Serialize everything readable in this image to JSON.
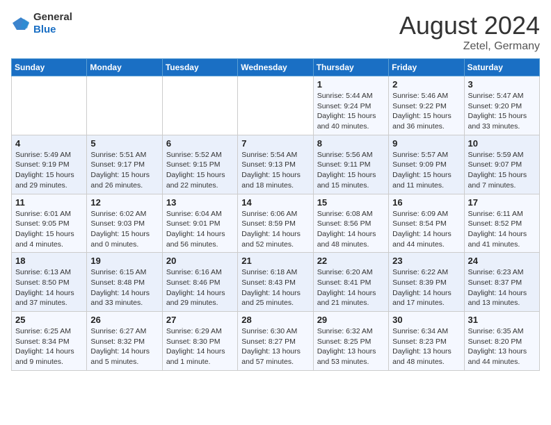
{
  "header": {
    "logo": {
      "general": "General",
      "blue": "Blue"
    },
    "title": "August 2024",
    "location": "Zetel, Germany"
  },
  "days_of_week": [
    "Sunday",
    "Monday",
    "Tuesday",
    "Wednesday",
    "Thursday",
    "Friday",
    "Saturday"
  ],
  "weeks": [
    [
      {
        "day": "",
        "info": ""
      },
      {
        "day": "",
        "info": ""
      },
      {
        "day": "",
        "info": ""
      },
      {
        "day": "",
        "info": ""
      },
      {
        "day": "1",
        "info": "Sunrise: 5:44 AM\nSunset: 9:24 PM\nDaylight: 15 hours\nand 40 minutes."
      },
      {
        "day": "2",
        "info": "Sunrise: 5:46 AM\nSunset: 9:22 PM\nDaylight: 15 hours\nand 36 minutes."
      },
      {
        "day": "3",
        "info": "Sunrise: 5:47 AM\nSunset: 9:20 PM\nDaylight: 15 hours\nand 33 minutes."
      }
    ],
    [
      {
        "day": "4",
        "info": "Sunrise: 5:49 AM\nSunset: 9:19 PM\nDaylight: 15 hours\nand 29 minutes."
      },
      {
        "day": "5",
        "info": "Sunrise: 5:51 AM\nSunset: 9:17 PM\nDaylight: 15 hours\nand 26 minutes."
      },
      {
        "day": "6",
        "info": "Sunrise: 5:52 AM\nSunset: 9:15 PM\nDaylight: 15 hours\nand 22 minutes."
      },
      {
        "day": "7",
        "info": "Sunrise: 5:54 AM\nSunset: 9:13 PM\nDaylight: 15 hours\nand 18 minutes."
      },
      {
        "day": "8",
        "info": "Sunrise: 5:56 AM\nSunset: 9:11 PM\nDaylight: 15 hours\nand 15 minutes."
      },
      {
        "day": "9",
        "info": "Sunrise: 5:57 AM\nSunset: 9:09 PM\nDaylight: 15 hours\nand 11 minutes."
      },
      {
        "day": "10",
        "info": "Sunrise: 5:59 AM\nSunset: 9:07 PM\nDaylight: 15 hours\nand 7 minutes."
      }
    ],
    [
      {
        "day": "11",
        "info": "Sunrise: 6:01 AM\nSunset: 9:05 PM\nDaylight: 15 hours\nand 4 minutes."
      },
      {
        "day": "12",
        "info": "Sunrise: 6:02 AM\nSunset: 9:03 PM\nDaylight: 15 hours\nand 0 minutes."
      },
      {
        "day": "13",
        "info": "Sunrise: 6:04 AM\nSunset: 9:01 PM\nDaylight: 14 hours\nand 56 minutes."
      },
      {
        "day": "14",
        "info": "Sunrise: 6:06 AM\nSunset: 8:59 PM\nDaylight: 14 hours\nand 52 minutes."
      },
      {
        "day": "15",
        "info": "Sunrise: 6:08 AM\nSunset: 8:56 PM\nDaylight: 14 hours\nand 48 minutes."
      },
      {
        "day": "16",
        "info": "Sunrise: 6:09 AM\nSunset: 8:54 PM\nDaylight: 14 hours\nand 44 minutes."
      },
      {
        "day": "17",
        "info": "Sunrise: 6:11 AM\nSunset: 8:52 PM\nDaylight: 14 hours\nand 41 minutes."
      }
    ],
    [
      {
        "day": "18",
        "info": "Sunrise: 6:13 AM\nSunset: 8:50 PM\nDaylight: 14 hours\nand 37 minutes."
      },
      {
        "day": "19",
        "info": "Sunrise: 6:15 AM\nSunset: 8:48 PM\nDaylight: 14 hours\nand 33 minutes."
      },
      {
        "day": "20",
        "info": "Sunrise: 6:16 AM\nSunset: 8:46 PM\nDaylight: 14 hours\nand 29 minutes."
      },
      {
        "day": "21",
        "info": "Sunrise: 6:18 AM\nSunset: 8:43 PM\nDaylight: 14 hours\nand 25 minutes."
      },
      {
        "day": "22",
        "info": "Sunrise: 6:20 AM\nSunset: 8:41 PM\nDaylight: 14 hours\nand 21 minutes."
      },
      {
        "day": "23",
        "info": "Sunrise: 6:22 AM\nSunset: 8:39 PM\nDaylight: 14 hours\nand 17 minutes."
      },
      {
        "day": "24",
        "info": "Sunrise: 6:23 AM\nSunset: 8:37 PM\nDaylight: 14 hours\nand 13 minutes."
      }
    ],
    [
      {
        "day": "25",
        "info": "Sunrise: 6:25 AM\nSunset: 8:34 PM\nDaylight: 14 hours\nand 9 minutes."
      },
      {
        "day": "26",
        "info": "Sunrise: 6:27 AM\nSunset: 8:32 PM\nDaylight: 14 hours\nand 5 minutes."
      },
      {
        "day": "27",
        "info": "Sunrise: 6:29 AM\nSunset: 8:30 PM\nDaylight: 14 hours\nand 1 minute."
      },
      {
        "day": "28",
        "info": "Sunrise: 6:30 AM\nSunset: 8:27 PM\nDaylight: 13 hours\nand 57 minutes."
      },
      {
        "day": "29",
        "info": "Sunrise: 6:32 AM\nSunset: 8:25 PM\nDaylight: 13 hours\nand 53 minutes."
      },
      {
        "day": "30",
        "info": "Sunrise: 6:34 AM\nSunset: 8:23 PM\nDaylight: 13 hours\nand 48 minutes."
      },
      {
        "day": "31",
        "info": "Sunrise: 6:35 AM\nSunset: 8:20 PM\nDaylight: 13 hours\nand 44 minutes."
      }
    ]
  ]
}
